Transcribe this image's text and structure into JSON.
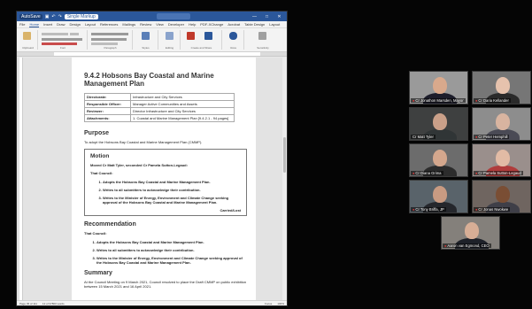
{
  "word": {
    "titlebar": {
      "autosave": "AutoSave",
      "doc_title": "Single Markup",
      "window_controls": [
        "—",
        "□",
        "✕"
      ]
    },
    "menu": [
      "File",
      "Home",
      "Insert",
      "Draw",
      "Design",
      "Layout",
      "References",
      "Mailings",
      "Review",
      "View",
      "Developer",
      "Help",
      "PDF-XChange",
      "Acrobat",
      "Table Design",
      "Layout"
    ],
    "ribbon_groups": [
      "Clipboard",
      "Font",
      "Paragraph",
      "Styles",
      "Editing",
      "Create and Share",
      "Voice",
      "Sensitivity"
    ],
    "document": {
      "heading": "9.4.2 Hobsons Bay Coastal and Marine Management Plan",
      "meta": [
        {
          "key": "Directorate:",
          "value": "Infrastructure and City Services"
        },
        {
          "key": "Responsible Officer:",
          "value": "Manager Active Communities and Assets"
        },
        {
          "key": "Reviewer:",
          "value": "Director Infrastructure and City Services"
        },
        {
          "key": "Attachments:",
          "value": "1. Coastal and Marine Management Plan [9.4.2.1 - 94 pages]"
        }
      ],
      "purpose_heading": "Purpose",
      "purpose_text": "To adopt the Hobsons Bay Coastal and Marine Management Plan (CMMP).",
      "motion": {
        "heading": "Motion",
        "moved": "Moved Cr Matt Tyler, seconded Cr Pamela Sutton-Legaud:",
        "that_council": "That Council:",
        "items": [
          "Adopts the Hobsons Bay Coastal and Marine Management Plan.",
          "Writes to all submitters to acknowledge their contribution.",
          "Writes to the Minister of Energy, Environment and Climate Change seeking approval of the Hobsons Bay Coastal and Marine Management Plan."
        ],
        "carried": "Carried/Lost"
      },
      "recommendation_heading": "Recommendation",
      "recommendation_that": "That Council:",
      "recommendation_items": [
        "Adopts the Hobsons Bay Coastal and Marine Management Plan.",
        "Writes to all submitters to acknowledge their contribution.",
        "Writes to the Minister of Energy, Environment and Climate Change seeking approval of the Hobsons Bay Coastal and Marine Management Plan."
      ],
      "summary_heading": "Summary",
      "summary_text": "At the Council Meeting on 9 March 2021, Council resolved to place the Draft CMMP on public exhibition between 15 March 2021 and 16 April 2021."
    },
    "status": {
      "page": "Page 45 of 111",
      "words": "12 of 37800 words",
      "focus": "Focus",
      "zoom": "100%"
    }
  },
  "participants": [
    {
      "name": "Cr Jonathon Marsden, Mayor",
      "bg": "#9a9a9a",
      "skin": "#d9a98c",
      "clothes": "#1d1d2b"
    },
    {
      "name": "Cr Daria Kellander",
      "bg": "#767676",
      "skin": "#e6c2ad",
      "clothes": "#2a2a2a"
    },
    {
      "name": "Cr Matt Tyler",
      "bg": "#3e4040",
      "skin": "#caa089",
      "clothes": "#303536"
    },
    {
      "name": "Cr Peter Hemphill",
      "bg": "#8d8d8d",
      "skin": "#d8b4a0",
      "clothes": "#4a4a55"
    },
    {
      "name": "Cr Diana Grima",
      "bg": "#6c6c6c",
      "skin": "#d4a78d",
      "clothes": "#2c2c2c"
    },
    {
      "name": "Cr Pamela Sutton-Legaud",
      "bg": "#9a8f8c",
      "skin": "#e2bba5",
      "clothes": "#b03c3c"
    },
    {
      "name": "Cr Tony Briffa, JP",
      "bg": "#59636a",
      "skin": "#c99b82",
      "clothes": "#25272c"
    },
    {
      "name": "Cr Jonas Nwokwe",
      "bg": "#6f6560",
      "skin": "#7a4e34",
      "clothes": "#3f3f48"
    },
    {
      "name": "Aaron van Egmond, CEO",
      "bg": "#84807b",
      "skin": "#d7ae96",
      "clothes": "#1e2129"
    }
  ]
}
